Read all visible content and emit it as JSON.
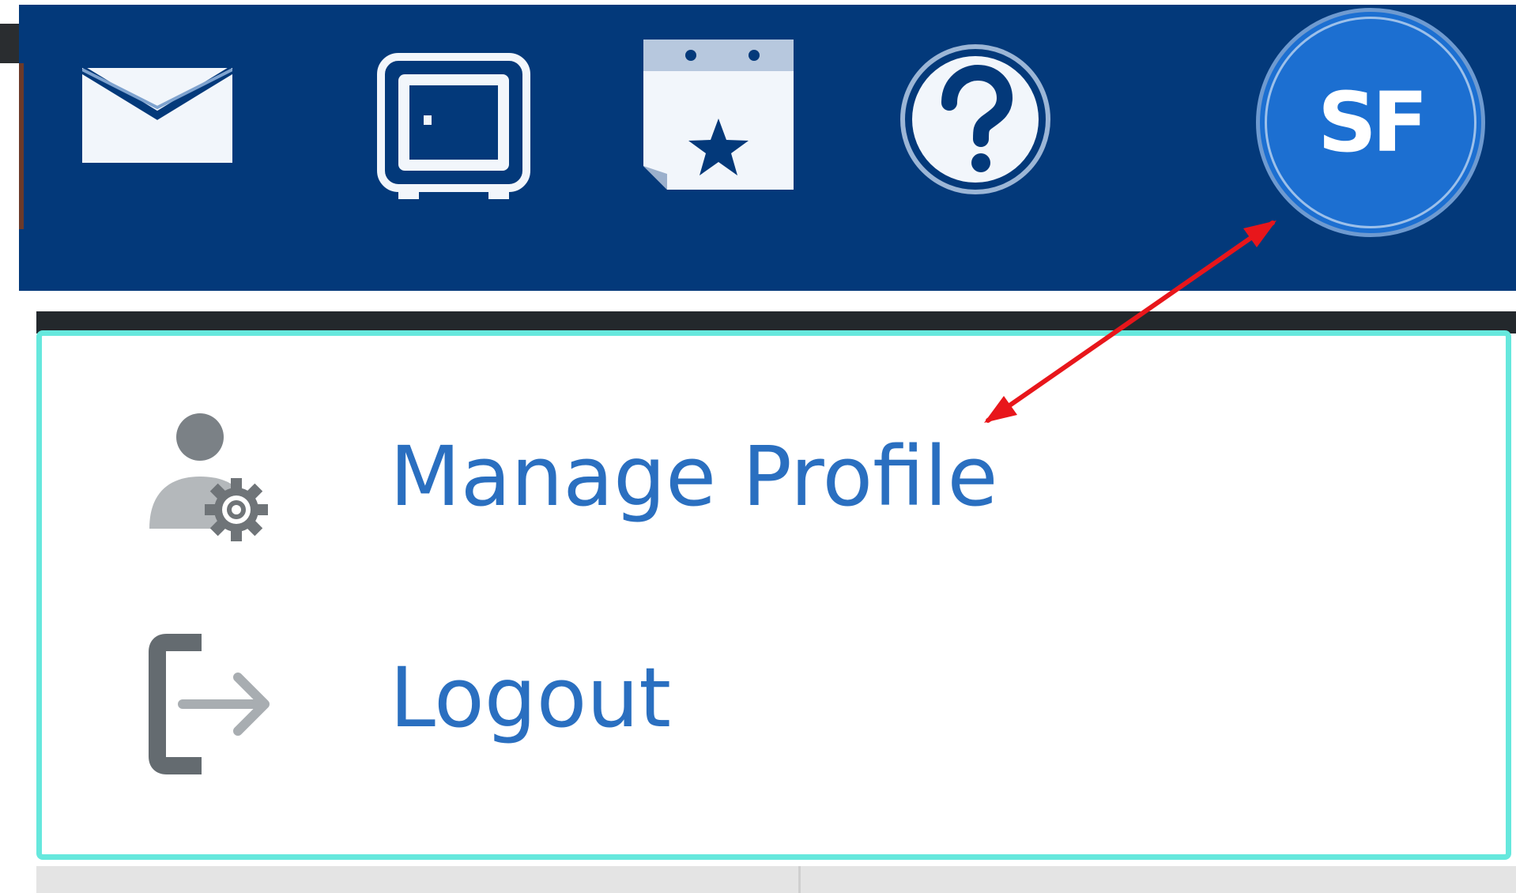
{
  "colors": {
    "topbar_background": "#03397a",
    "avatar_background": "#1c6fd1",
    "dropdown_border": "#66e8dd",
    "menu_label": "#2a6fc0",
    "annotation_arrow": "#e8161b"
  },
  "topbar": {
    "icons": [
      "mail-icon",
      "vault-icon",
      "calendar-star-icon",
      "help-icon"
    ],
    "avatar": {
      "initials": "SF"
    }
  },
  "dropdown": {
    "items": [
      {
        "label": "Manage Profile",
        "icon": "user-gear-icon"
      },
      {
        "label": "Logout",
        "icon": "logout-icon"
      }
    ]
  }
}
